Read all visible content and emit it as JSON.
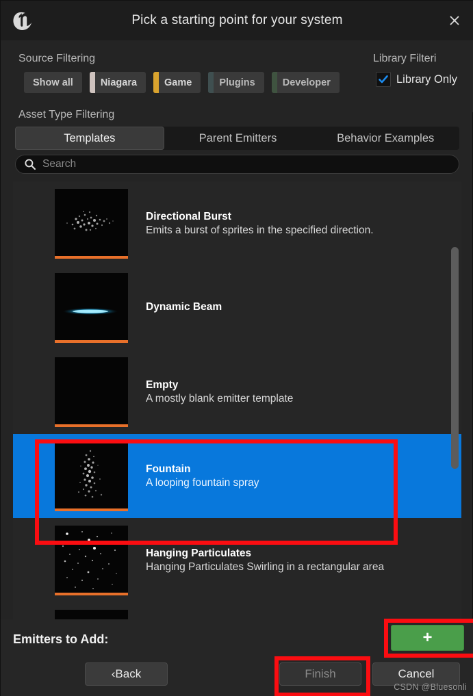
{
  "window": {
    "title": "Pick a starting point for your system",
    "logo_icon": "unreal-engine-logo",
    "close_icon": "close-icon"
  },
  "source_filtering": {
    "label": "Source Filtering",
    "chips": [
      {
        "label": "Show all",
        "stripe": null,
        "active": false
      },
      {
        "label": "Niagara",
        "stripe": "#cfc3bf",
        "active": true
      },
      {
        "label": "Game",
        "stripe": "#d9a32e",
        "active": true
      },
      {
        "label": "Plugins",
        "stripe": "#3f4f50",
        "active": false
      },
      {
        "label": "Developer",
        "stripe": "#3f5340",
        "active": false
      }
    ]
  },
  "library_filtering": {
    "label": "Library Filteri",
    "checkbox_label": "Library Only",
    "checked": true,
    "check_icon": "checkmark-icon",
    "accent": "#1c8cf0"
  },
  "asset_type_filtering": {
    "label": "Asset Type Filtering",
    "tabs": [
      {
        "label": "Templates",
        "active": true
      },
      {
        "label": "Parent Emitters",
        "active": false
      },
      {
        "label": "Behavior Examples",
        "active": false
      }
    ]
  },
  "search": {
    "icon": "search-icon",
    "placeholder": "Search",
    "value": ""
  },
  "templates": {
    "selection_color": "#0878dc",
    "items": [
      {
        "title": "Directional Burst",
        "description": "Emits a burst of sprites in the specified direction.",
        "thumbnail": "directional-burst-thumbnail",
        "selected": false
      },
      {
        "title": "Dynamic Beam",
        "description": "",
        "thumbnail": "dynamic-beam-thumbnail",
        "selected": false
      },
      {
        "title": "Empty",
        "description": "A mostly blank emitter template",
        "thumbnail": "empty-thumbnail",
        "selected": false
      },
      {
        "title": "Fountain",
        "description": "A looping fountain spray",
        "thumbnail": "fountain-thumbnail",
        "selected": true
      },
      {
        "title": "Hanging Particulates",
        "description": "Hanging Particulates Swirling in a rectangular area",
        "thumbnail": "hanging-particulates-thumbnail",
        "selected": false
      }
    ]
  },
  "footer": {
    "emitters_label": "Emitters to Add:",
    "add_button": "+",
    "add_button_color": "#4a9e4a",
    "back_button": "‹Back",
    "finish_button": "Finish",
    "cancel_button": "Cancel"
  },
  "watermark": "CSDN @Bluesonli",
  "annotations": {
    "color": "#fb0d11"
  }
}
